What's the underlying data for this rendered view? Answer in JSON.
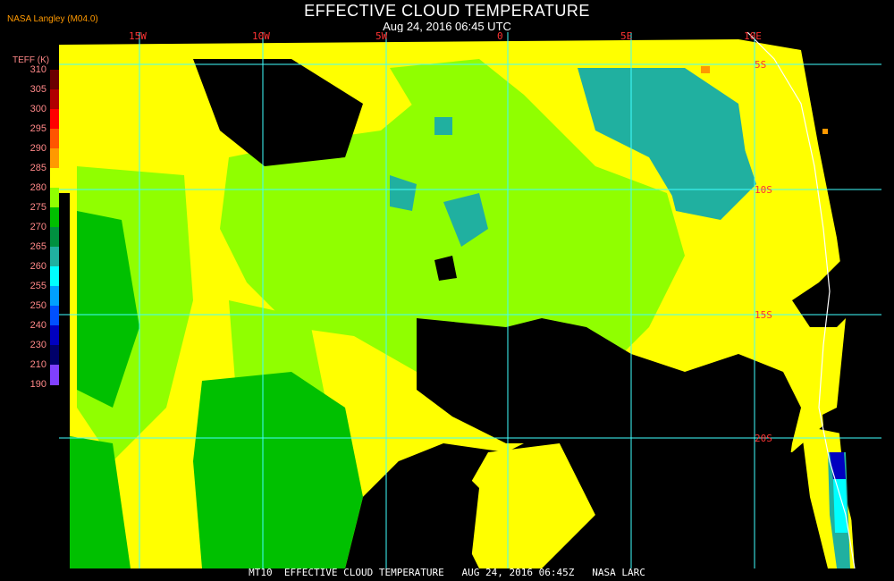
{
  "header": {
    "source": "NASA Langley (M04.0)",
    "title": "EFFECTIVE CLOUD TEMPERATURE",
    "subtitle": "Aug 24, 2016 06:45 UTC"
  },
  "legend": {
    "label": "TEFF (K)",
    "ticks": [
      "310",
      "305",
      "300",
      "295",
      "290",
      "285",
      "280",
      "275",
      "270",
      "265",
      "260",
      "255",
      "250",
      "240",
      "230",
      "210",
      "190"
    ],
    "colors": [
      "#6b0000",
      "#b00000",
      "#ff0000",
      "#ff5500",
      "#ff9900",
      "#ffff00",
      "#90ff00",
      "#00c000",
      "#009040",
      "#20b0a0",
      "#00ffff",
      "#00a0ff",
      "#0050ff",
      "#0000c0",
      "#00006a",
      "#8040ff"
    ]
  },
  "map": {
    "lon_labels": [
      "15W",
      "10W",
      "5W",
      "0",
      "5E",
      "10E"
    ],
    "lat_labels": [
      "5S",
      "10S",
      "15S",
      "20S"
    ],
    "grid_color": "#40ffff",
    "cloud_colors": {
      "warm_yellow": "#ffff00",
      "low_green": "#90ff00",
      "mid_green": "#00c000",
      "teal": "#20b0a0",
      "cyan": "#00ffff",
      "blue": "#0000c0",
      "orange": "#ff9900"
    }
  },
  "footer": {
    "text": "MT10  EFFECTIVE CLOUD TEMPERATURE   AUG 24, 2016 06:45Z   NASA LARC"
  }
}
